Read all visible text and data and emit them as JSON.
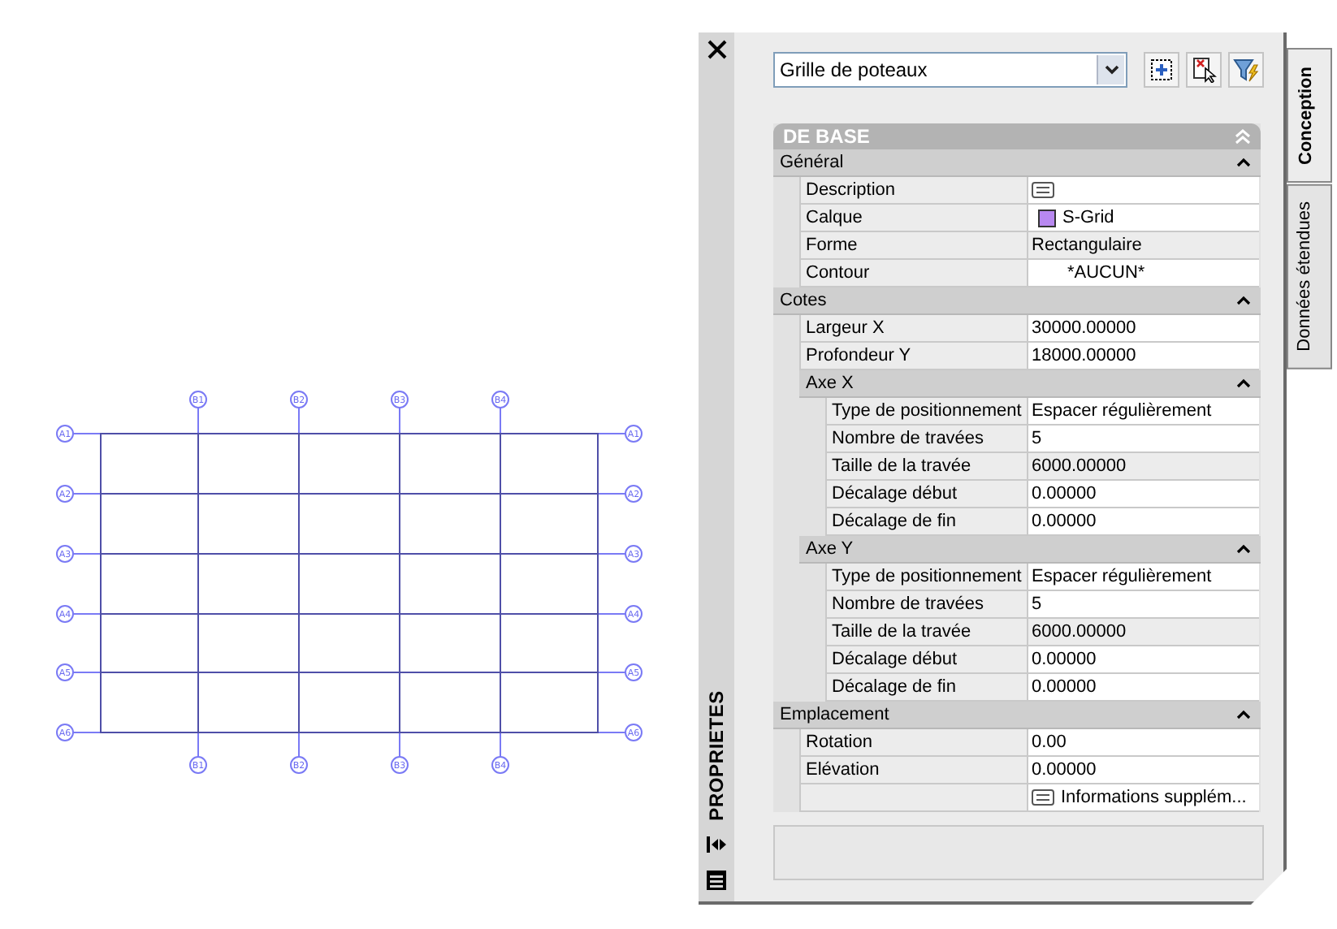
{
  "drawing": {
    "top_bubbles": [
      "B1",
      "B2",
      "B3",
      "B4"
    ],
    "bottom_bubbles": [
      "B1",
      "B2",
      "B3",
      "B4"
    ],
    "left_bubbles": [
      "A1",
      "A2",
      "A3",
      "A4",
      "A5",
      "A6"
    ],
    "right_bubbles": [
      "A1",
      "A2",
      "A3",
      "A4",
      "A5",
      "A6"
    ]
  },
  "palette": {
    "title": "PROPRIETES",
    "object_type": {
      "value": "Grille de poteaux"
    },
    "section": {
      "label": "DE BASE",
      "expanded": true
    },
    "categories": [
      {
        "kind": "category",
        "label": "Général",
        "expanded": true,
        "children": [
          {
            "kind": "icon",
            "label": "Description",
            "readonly": false
          },
          {
            "kind": "swatch",
            "label": "Calque",
            "value": "S-Grid",
            "color": "#b888f0",
            "readonly": false
          },
          {
            "kind": "text",
            "label": "Forme",
            "value": "Rectangulaire",
            "readonly": true
          },
          {
            "kind": "indented",
            "label": "Contour",
            "value": "*AUCUN*",
            "readonly": false
          }
        ]
      },
      {
        "kind": "category",
        "label": "Cotes",
        "expanded": true,
        "children": [
          {
            "kind": "text",
            "label": "Largeur X",
            "value": "30000.00000",
            "readonly": false
          },
          {
            "kind": "text",
            "label": "Profondeur Y",
            "value": "18000.00000",
            "readonly": false
          },
          {
            "kind": "category",
            "label": "Axe X",
            "expanded": true,
            "children": [
              {
                "kind": "text",
                "label": "Type de positionnement",
                "value": "Espacer régulièrement",
                "readonly": false
              },
              {
                "kind": "text",
                "label": "Nombre de travées",
                "value": "5",
                "readonly": false
              },
              {
                "kind": "text",
                "label": "Taille de la travée",
                "value": "6000.00000",
                "readonly": true
              },
              {
                "kind": "text",
                "label": "Décalage début",
                "value": "0.00000",
                "readonly": false
              },
              {
                "kind": "text",
                "label": "Décalage de fin",
                "value": "0.00000",
                "readonly": false
              }
            ]
          },
          {
            "kind": "category",
            "label": "Axe Y",
            "expanded": true,
            "children": [
              {
                "kind": "text",
                "label": "Type de positionnement",
                "value": "Espacer régulièrement",
                "readonly": false
              },
              {
                "kind": "text",
                "label": "Nombre de travées",
                "value": "5",
                "readonly": false
              },
              {
                "kind": "text",
                "label": "Taille de la travée",
                "value": "6000.00000",
                "readonly": true
              },
              {
                "kind": "text",
                "label": "Décalage début",
                "value": "0.00000",
                "readonly": false
              },
              {
                "kind": "text",
                "label": "Décalage de fin",
                "value": "0.00000",
                "readonly": false
              }
            ]
          }
        ]
      },
      {
        "kind": "category",
        "label": "Emplacement",
        "expanded": true,
        "children": [
          {
            "kind": "text",
            "label": "Rotation",
            "value": "0.00",
            "readonly": false
          },
          {
            "kind": "text",
            "label": "Elévation",
            "value": "0.00000",
            "readonly": false
          },
          {
            "kind": "icon_text",
            "value": "Informations supplém...",
            "readonly": false
          }
        ]
      }
    ],
    "tabs": [
      {
        "label": "Conception",
        "selected": true
      },
      {
        "label": "Données étendues",
        "selected": false
      }
    ]
  }
}
